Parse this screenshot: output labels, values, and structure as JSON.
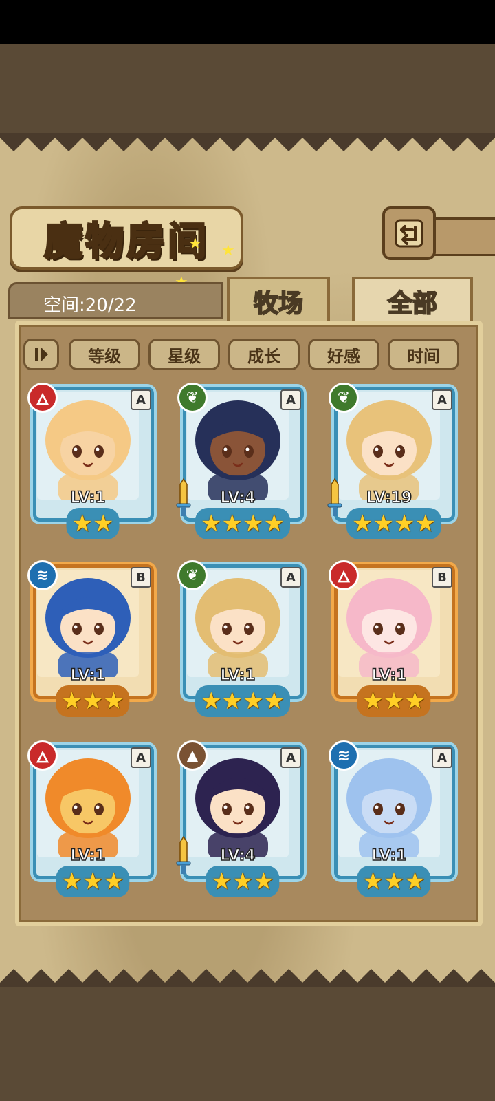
{
  "title": "魔物房间",
  "space": {
    "label": "空间:20/22"
  },
  "tabs": [
    {
      "label": "牧场",
      "active": true
    },
    {
      "label": "全部",
      "active": false
    }
  ],
  "sort_buttons": [
    "等级",
    "星级",
    "成长",
    "好感",
    "时间"
  ],
  "sort_toggle_icon": "sort-order-icon",
  "back_icon": "back-arrow-icon",
  "colors": {
    "fire": "#c92a2a",
    "leaf": "#3f7a2c",
    "water": "#1e6fb0",
    "earth": "#7a5233",
    "frame_blue": "#3a8fb5",
    "frame_orange": "#c5731f",
    "star": "#ffcf26"
  },
  "monsters": [
    {
      "element": "fire",
      "element_icon": "fire-icon",
      "rank": "A",
      "level": "LV:1",
      "stars": 2,
      "frame": "blue",
      "sword": false,
      "hair": "#f5c985",
      "skin": "#f7d3a3"
    },
    {
      "element": "leaf",
      "element_icon": "leaf-icon",
      "rank": "A",
      "level": "LV:4",
      "stars": 4,
      "frame": "blue",
      "sword": true,
      "hair": "#263059",
      "skin": "#8a5438"
    },
    {
      "element": "leaf",
      "element_icon": "leaf-icon",
      "rank": "A",
      "level": "LV:19",
      "stars": 4,
      "frame": "blue",
      "sword": true,
      "hair": "#e8c27a",
      "skin": "#fbe1c6"
    },
    {
      "element": "water",
      "element_icon": "water-icon",
      "rank": "B",
      "level": "LV:1",
      "stars": 3,
      "frame": "orange",
      "sword": false,
      "hair": "#2e5fb8",
      "skin": "#fbe1c6"
    },
    {
      "element": "leaf",
      "element_icon": "leaf-icon",
      "rank": "A",
      "level": "LV:1",
      "stars": 4,
      "frame": "blue",
      "sword": false,
      "hair": "#e3bd72",
      "skin": "#fbe1c6"
    },
    {
      "element": "fire",
      "element_icon": "fire-icon",
      "rank": "B",
      "level": "LV:1",
      "stars": 3,
      "frame": "orange",
      "sword": false,
      "hair": "#f6b8c9",
      "skin": "#fde6e3"
    },
    {
      "element": "fire",
      "element_icon": "fire-icon",
      "rank": "A",
      "level": "LV:1",
      "stars": 3,
      "frame": "blue",
      "sword": false,
      "hair": "#f08a2a",
      "skin": "#f7c766"
    },
    {
      "element": "earth",
      "element_icon": "earth-icon",
      "rank": "A",
      "level": "LV:4",
      "stars": 3,
      "frame": "blue",
      "sword": true,
      "hair": "#2d2350",
      "skin": "#fbe1c6"
    },
    {
      "element": "water",
      "element_icon": "water-icon",
      "rank": "A",
      "level": "LV:1",
      "stars": 3,
      "frame": "blue",
      "sword": false,
      "hair": "#9ec2ee",
      "skin": "#c9dcf5"
    }
  ]
}
